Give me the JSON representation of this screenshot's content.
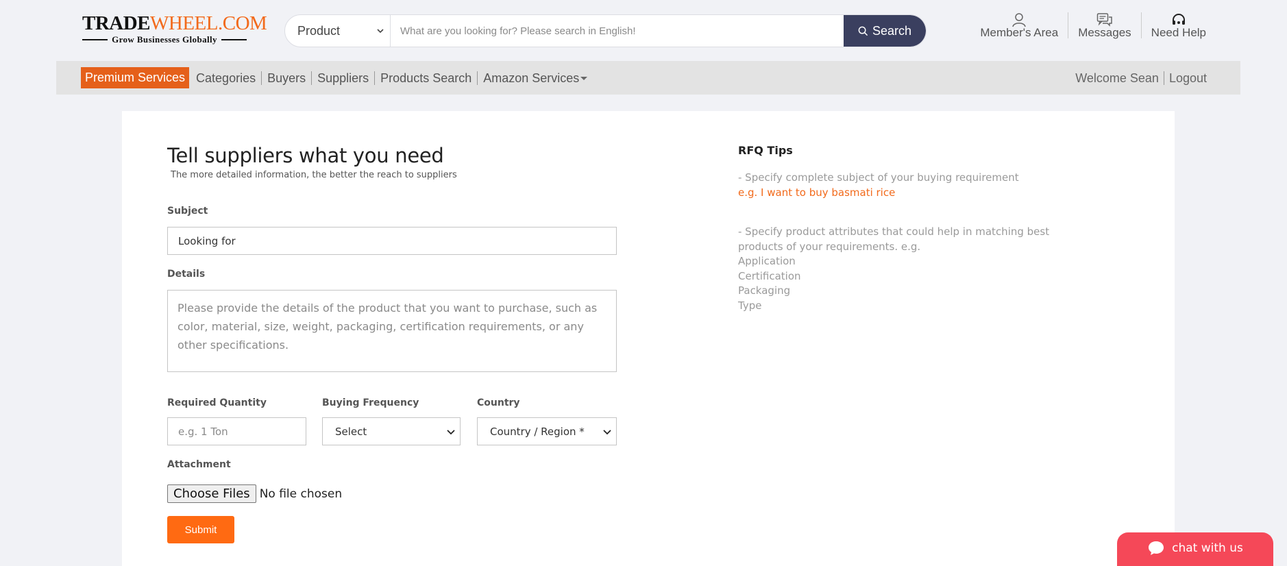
{
  "logo": {
    "trade": "TRADE",
    "wheel": "WHEEL.COM",
    "tagline": "Grow Businesses Globally"
  },
  "search": {
    "category": "Product",
    "placeholder": "What are you looking for? Please search in English!",
    "button_label": "Search"
  },
  "top_links": [
    {
      "label": "Member's Area",
      "icon": "user-icon"
    },
    {
      "label": "Messages",
      "icon": "chat-bubbles-icon"
    },
    {
      "label": "Need Help",
      "icon": "headset-icon"
    }
  ],
  "nav": {
    "premium": "Premium Services",
    "items": [
      "Categories",
      "Buyers",
      "Suppliers",
      "Products Search",
      "Amazon Services"
    ],
    "welcome": "Welcome Sean",
    "logout": "Logout"
  },
  "form": {
    "title": "Tell suppliers what you need",
    "subtitle": "The more detailed information, the better the reach to suppliers",
    "subject_label": "Subject",
    "subject_value": "Looking for",
    "details_label": "Details",
    "details_placeholder": "Please provide the details of the product that you want to purchase, such as color, material, size, weight, packaging, certification requirements, or any other specifications.",
    "quantity_label": "Required Quantity",
    "quantity_placeholder": "e.g. 1 Ton",
    "frequency_label": "Buying Frequency",
    "frequency_value": "Select",
    "country_label": "Country",
    "country_value": "Country / Region *",
    "attachment_label": "Attachment",
    "file_button": "Choose Files",
    "file_status": "No file chosen",
    "submit_label": "Submit"
  },
  "tips": {
    "title": "RFQ Tips",
    "tip1": "- Specify complete subject of your buying requirement",
    "tip1_example": "e.g. I want to buy basmati rice",
    "tip2": "- Specify product attributes that could help in matching best products of your requirements. e.g.",
    "attributes": [
      "Application",
      "Certification",
      "Packaging",
      "Type"
    ]
  },
  "chat": {
    "label": "chat with us"
  },
  "colors": {
    "brand_orange": "#f26a1b",
    "premium_bg": "#e5601a",
    "search_btn": "#3a3f5f",
    "submit": "#ff6a12",
    "chat": "#f54858"
  }
}
